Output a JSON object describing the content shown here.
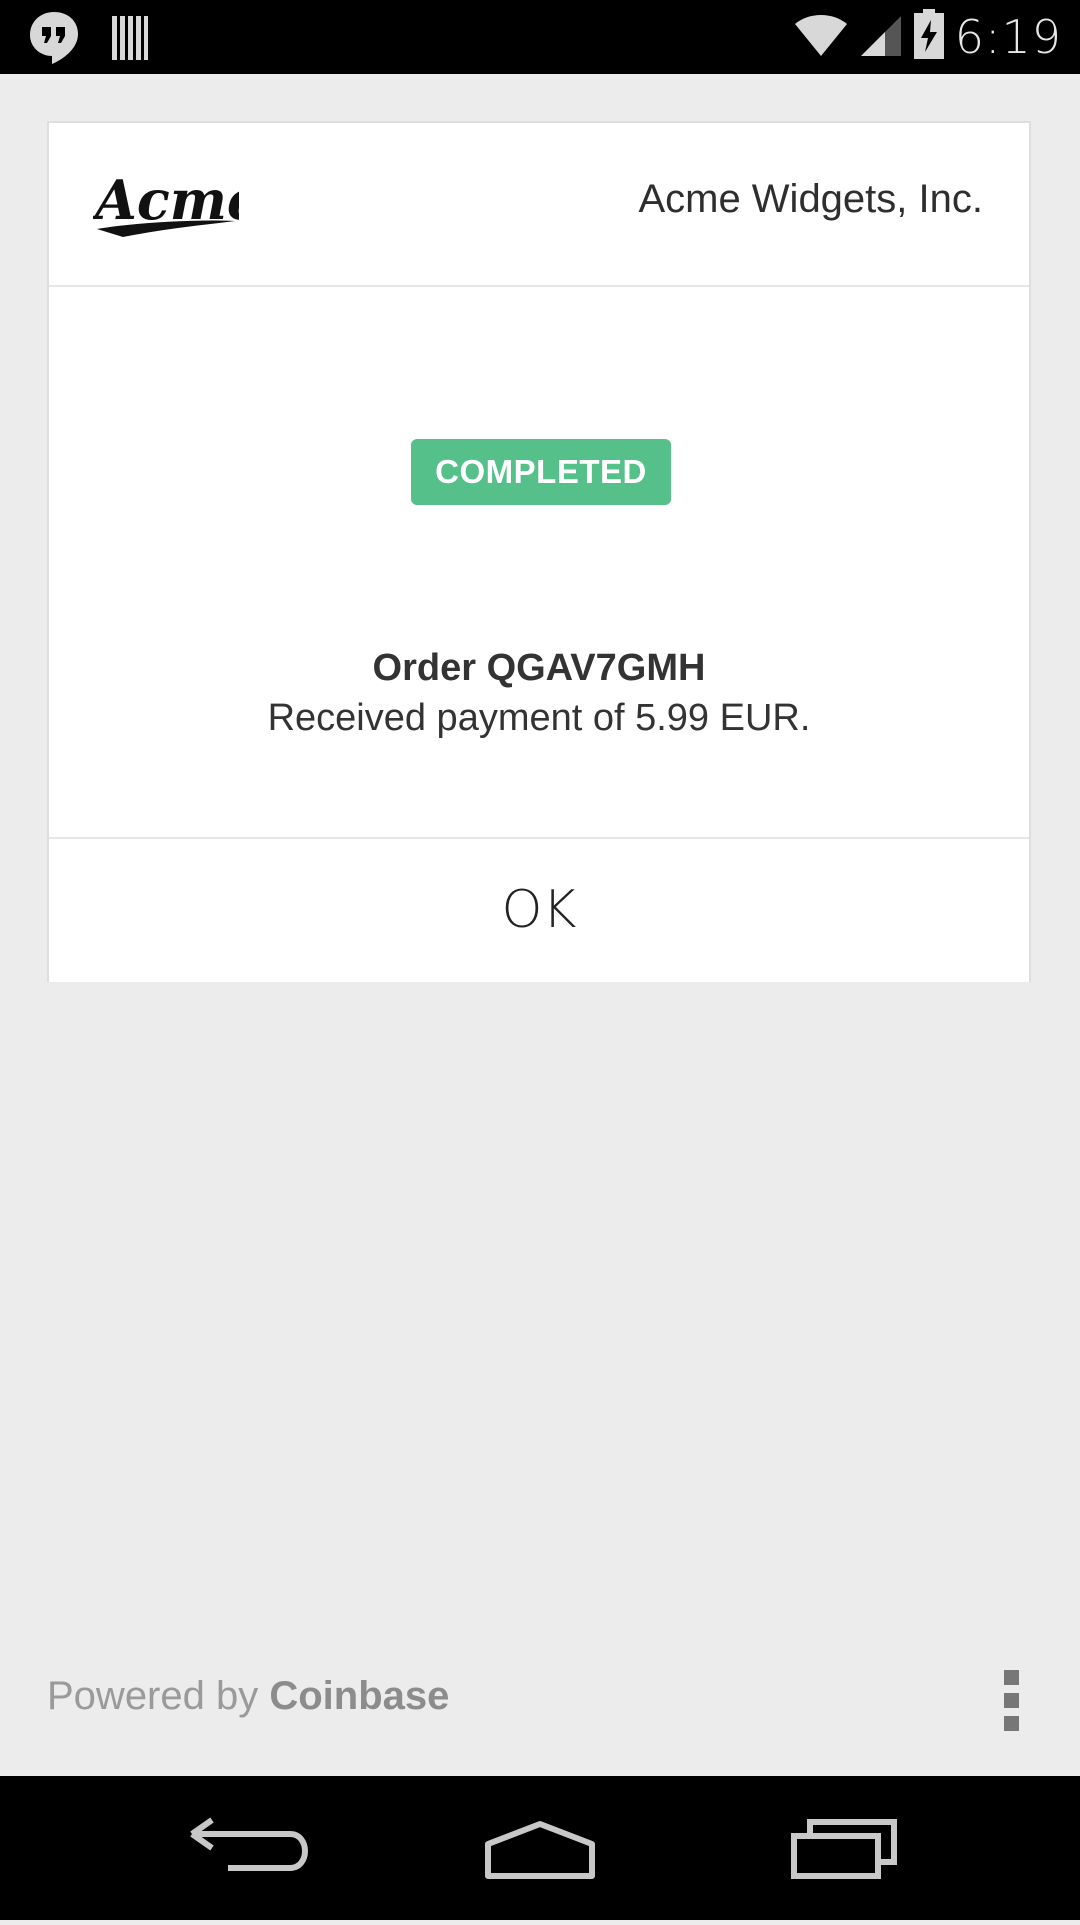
{
  "status_bar": {
    "time": "6:19",
    "icons": [
      "hangouts-icon",
      "barcode-icon",
      "wifi-icon",
      "cell-signal-icon",
      "battery-charging-icon"
    ]
  },
  "card": {
    "logo_text": "Acme",
    "merchant_name": "Acme Widgets, Inc.",
    "status_badge": "COMPLETED",
    "status_color": "#55c08a",
    "order_title": "Order QGAV7GMH",
    "order_description": "Received payment of 5.99 EUR.",
    "ok_label": "OK"
  },
  "footer": {
    "powered_prefix": "Powered by",
    "powered_brand": "Coinbase",
    "menu_icon": "overflow-menu-icon"
  },
  "nav_bar": {
    "buttons": [
      "back-icon",
      "home-icon",
      "recents-icon"
    ]
  }
}
